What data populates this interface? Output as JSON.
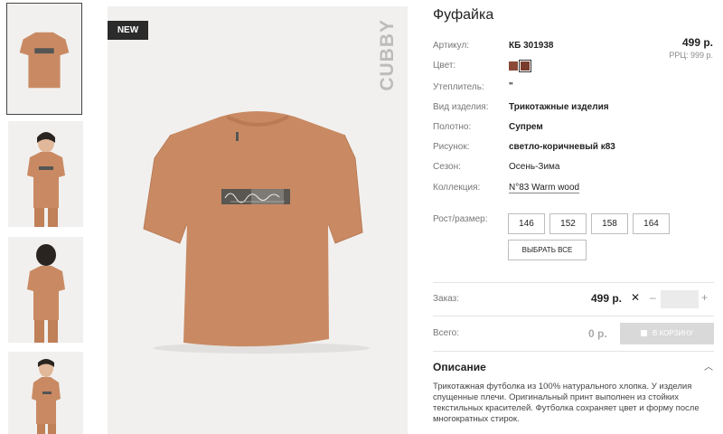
{
  "product": {
    "title": "Фуфайка",
    "badge": "NEW",
    "brand": "CUBBY",
    "price": "499 р.",
    "rrp": "РРЦ: 999 р."
  },
  "attributes": [
    {
      "label": "Артикул:",
      "value": "КБ 301938"
    },
    {
      "label": "Цвет:",
      "value": ""
    },
    {
      "label": "Утеплитель:",
      "value": "\""
    },
    {
      "label": "Вид изделия:",
      "value": "Трикотажные изделия"
    },
    {
      "label": "Полотно:",
      "value": "Супрем"
    },
    {
      "label": "Рисунок:",
      "value": "светло-коричневый к83"
    },
    {
      "label": "Сезон:",
      "value": "Осень-Зима"
    },
    {
      "label": "Коллекция:",
      "value": "N°83 Warm wood"
    }
  ],
  "colors": {
    "swatch_1": "#8b4a36",
    "swatch_2": "#7a3c2c",
    "shirt": "#c98a63",
    "shirt_shade": "#b97a55",
    "background": "#f1f0ef"
  },
  "sizes": {
    "label": "Рост/размер:",
    "options": [
      "146",
      "152",
      "158",
      "164"
    ],
    "select_all": "ВЫБРАТЬ ВСЕ"
  },
  "order": {
    "label": "Заказ:",
    "price": "499 р.",
    "times": "✕",
    "minus": "–",
    "plus": "+",
    "quantity": ""
  },
  "total": {
    "label": "Всего:",
    "value": "0 р.",
    "cart_button": "В КОРЗИНУ"
  },
  "description": {
    "title": "Описание",
    "text": "Трикотажная футболка из 100% натурального хлопка. У изделия спущенные плечи. Оригинальный принт выполнен из стойких текстильных красителей. Футболка сохраняет цвет и форму после многократных стирок."
  },
  "icons": {
    "chevron": "chevron-up-icon",
    "cart": "cart-icon"
  }
}
